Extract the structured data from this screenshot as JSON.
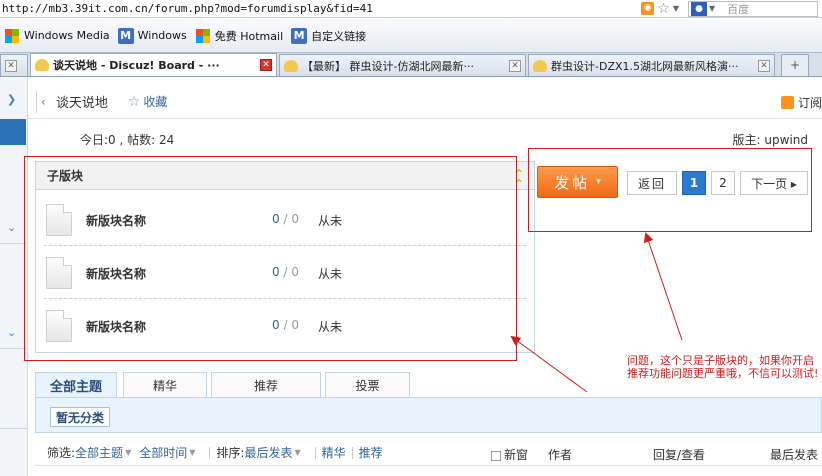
{
  "browser": {
    "url": "http://mb3.39it.com.cn/forum.php?mod=forumdisplay&fid=41",
    "search_placeholder": "百度"
  },
  "links_bar": [
    {
      "label": "Windows Media",
      "icon": "windows-logo-icon"
    },
    {
      "label": "Windows",
      "icon": "m-logo-icon"
    },
    {
      "label": "免费 Hotmail",
      "icon": "windows-logo-icon"
    },
    {
      "label": "自定义链接",
      "icon": "m-logo-icon"
    }
  ],
  "tabs": [
    {
      "label": "谈天说地 - Discuz! Board - ···",
      "active": true
    },
    {
      "label": "【最新】 群虫设计-仿湖北网最新···",
      "active": false
    },
    {
      "label": "群虫设计-DZX1.5湖北网最新风格演···",
      "active": false
    }
  ],
  "breadcrumb": {
    "title": "谈天说地",
    "favorite_label": "收藏",
    "subscribe_label": "订阅"
  },
  "stats": {
    "text": "今日:0 , 帖数: 24",
    "moderator_label": "版主:",
    "moderator": "upwind"
  },
  "subforums": {
    "title": "子版块",
    "items": [
      {
        "name": "新版块名称",
        "threads": "0",
        "sep": "/",
        "posts": "0",
        "last": "从未"
      },
      {
        "name": "新版块名称",
        "threads": "0",
        "sep": "/",
        "posts": "0",
        "last": "从未"
      },
      {
        "name": "新版块名称",
        "threads": "0",
        "sep": "/",
        "posts": "0",
        "last": "从未"
      }
    ]
  },
  "post_button": {
    "label": "发帖",
    "arrow": "▾"
  },
  "pager": {
    "back": "返回",
    "pages": [
      "1",
      "2"
    ],
    "current": "1",
    "next": "下一页 ▸"
  },
  "annotation": "问题，这个只是子版块的，如果你开启推荐功能问题更严重哦，不信可以测试!",
  "thread_tabs": [
    "全部主题",
    "精华",
    "推荐",
    "投票"
  ],
  "type_filter": {
    "label": "暂无分类"
  },
  "filter_bar": {
    "filter_label": "筛选:",
    "all_threads": "全部主题",
    "all_time": "全部时间",
    "sort_label": "排序:",
    "sort_value": "最后发表",
    "digest": "精华",
    "recommend": "推荐",
    "new_window": "新窗",
    "author": "作者",
    "replies_views": "回复/查看",
    "last_post": "最后发表"
  },
  "colors": {
    "accent": "#2b7acd",
    "post_button": "#f06a17",
    "annotation": "#d21c1c"
  }
}
